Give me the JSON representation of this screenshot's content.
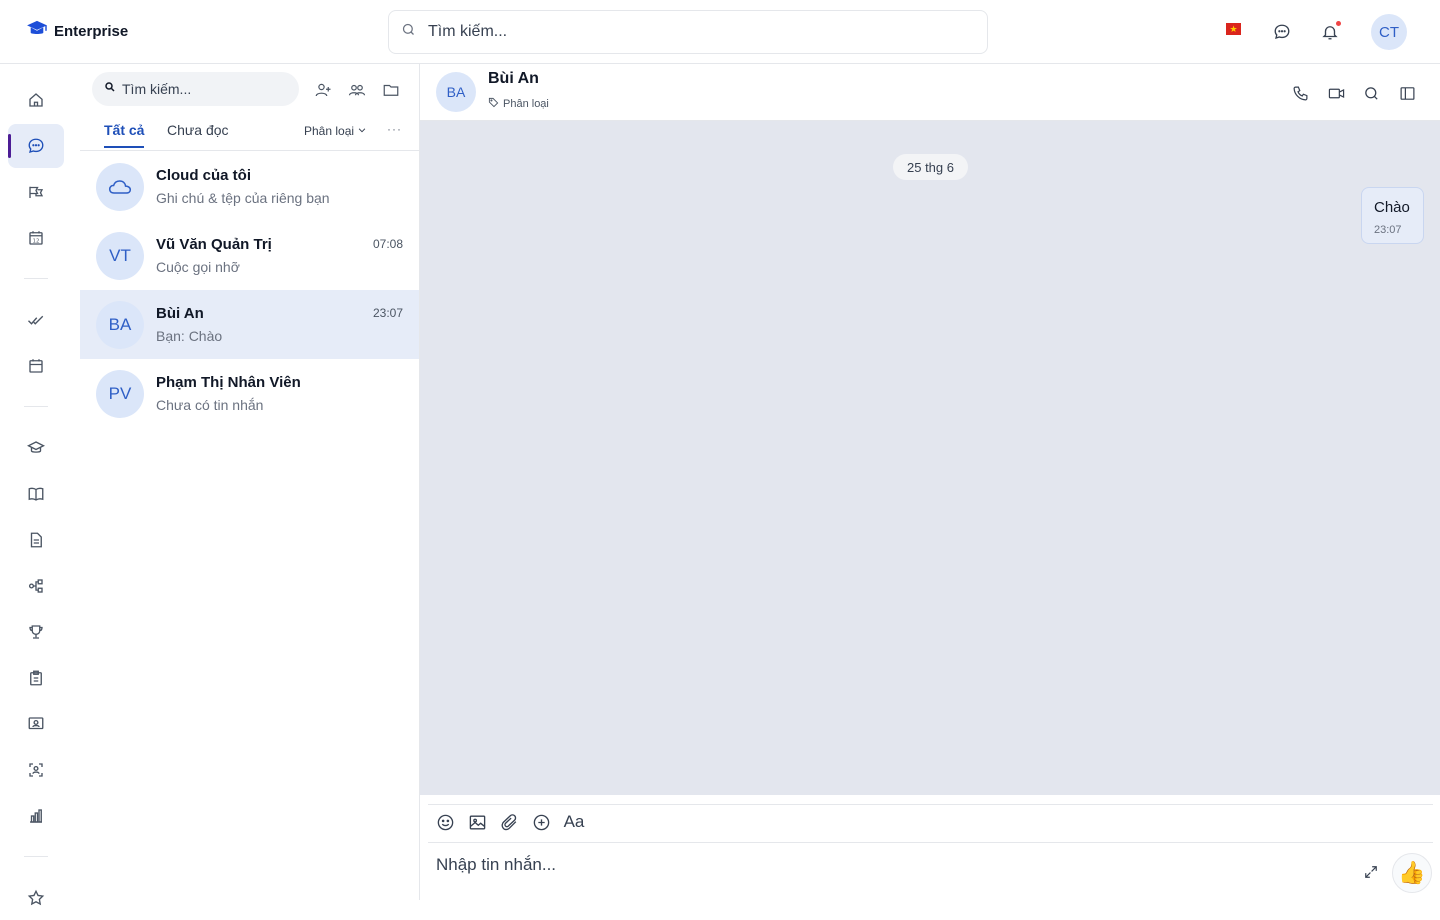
{
  "app": {
    "title": "Enterprise"
  },
  "topbar": {
    "search_placeholder": "Tìm kiếm...",
    "flag_symbol": "★",
    "user_initials": "CT",
    "icons": [
      "search-icon",
      "flag-vn-icon",
      "chat-icon",
      "bell-icon"
    ]
  },
  "conversations": {
    "search_placeholder": "Tìm kiếm...",
    "tabs": [
      {
        "label": "Tất cả"
      },
      {
        "label": "Chưa đọc"
      }
    ],
    "filter_label": "Phân loại",
    "more_label": "···",
    "items": [
      {
        "initials": "",
        "name": "Cloud của tôi",
        "preview": "Ghi chú & tệp của riêng bạn",
        "time": ""
      },
      {
        "initials": "VT",
        "name": "Vũ Văn Quản Trị",
        "preview": "Cuộc gọi nhỡ",
        "time": "07:08"
      },
      {
        "initials": "BA",
        "name": "Bùi An",
        "preview": "Bạn: Chào",
        "time": "23:07"
      },
      {
        "initials": "PV",
        "name": "Phạm Thị Nhân Viên",
        "preview": "Chưa có tin nhắn",
        "time": ""
      }
    ]
  },
  "chat": {
    "initials": "BA",
    "name": "Bùi An",
    "tag": "Phân loại",
    "date_divider": "25 thg 6",
    "messages": [
      {
        "text": "Chào",
        "time": "23:07",
        "outgoing": true
      }
    ],
    "composer": {
      "placeholder": "Nhập tin nhắn...",
      "like": "👍",
      "format_label": "Aa"
    }
  },
  "colors": {
    "accent": "#1e4fb8",
    "rail_active_bar": "#4c1d95",
    "selected_bg": "#e6ecf8",
    "chat_bg": "#e3e6ee"
  }
}
